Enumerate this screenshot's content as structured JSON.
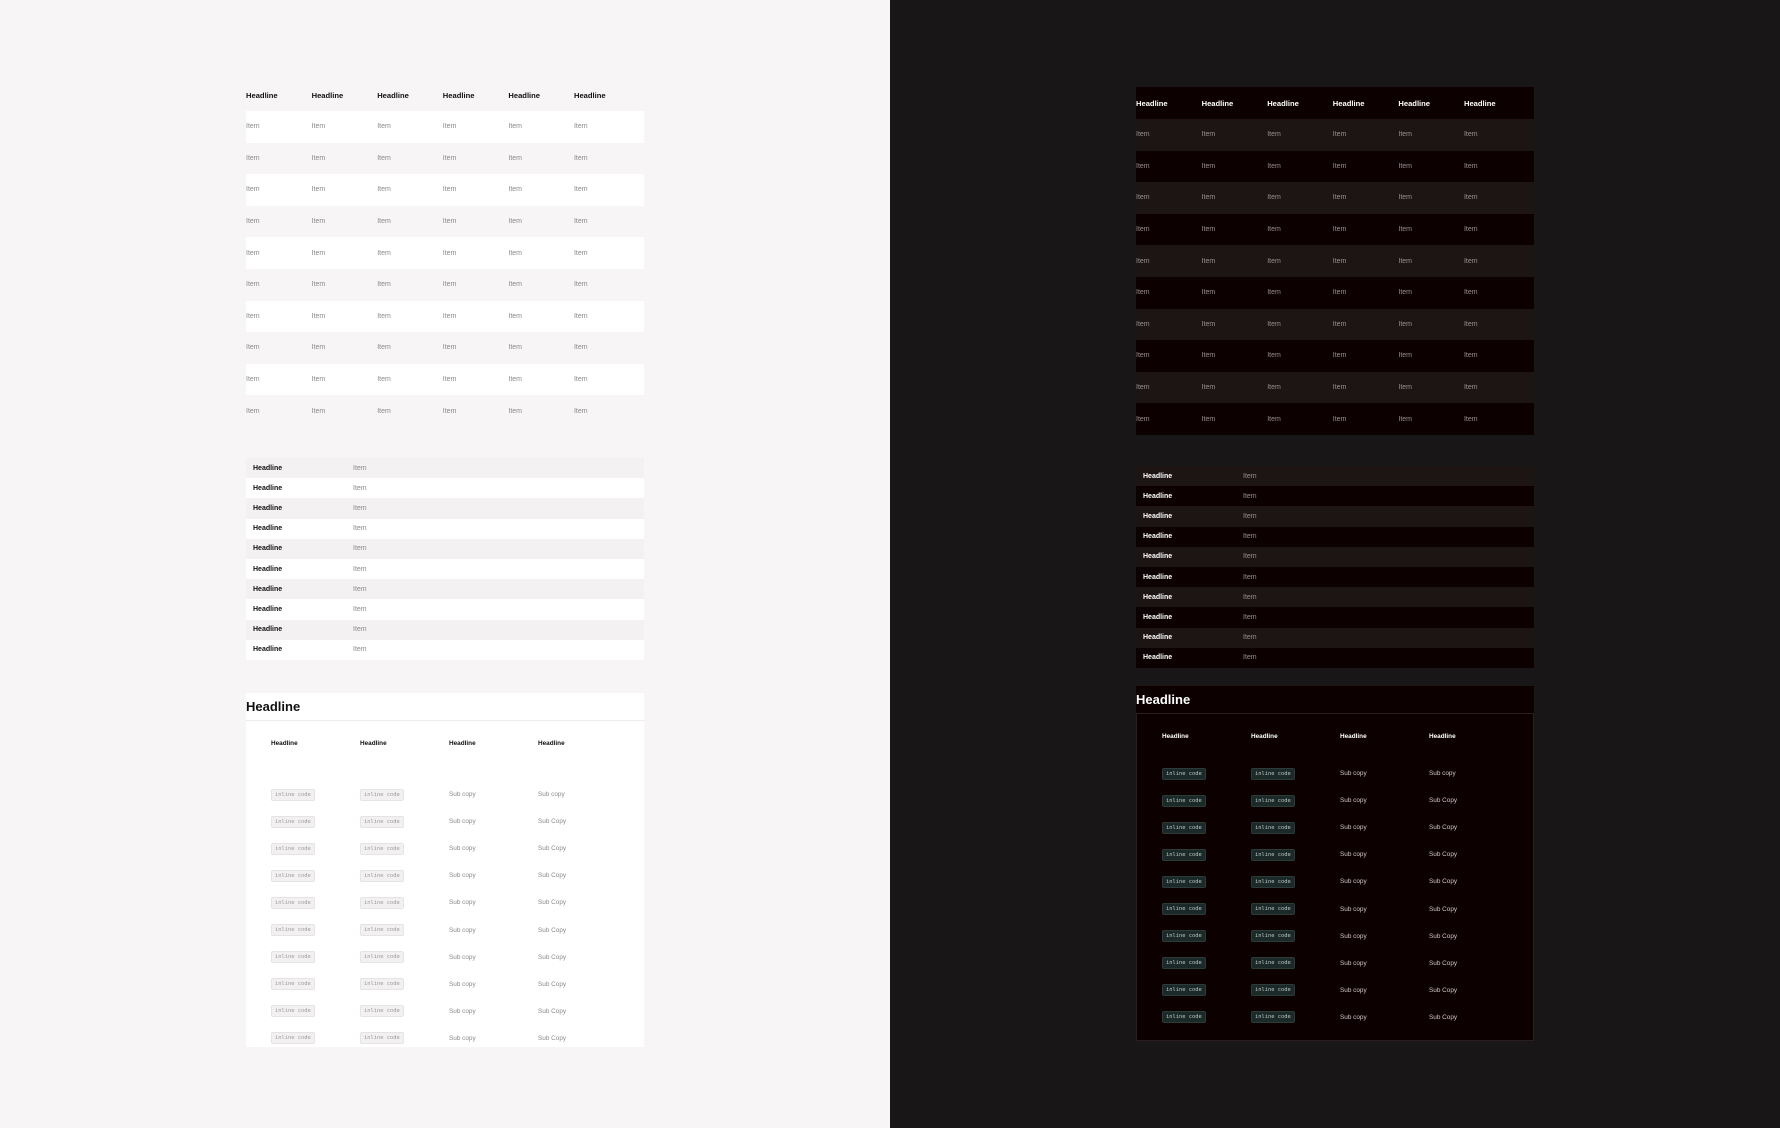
{
  "light": {
    "grid": {
      "headers": [
        "Headline",
        "Headline",
        "Headline",
        "Headline",
        "Headline",
        "Headline"
      ],
      "rows": [
        [
          "Item",
          "Item",
          "Item",
          "Item",
          "Item",
          "Item"
        ],
        [
          "Item",
          "Item",
          "Item",
          "Item",
          "Item",
          "Item"
        ],
        [
          "Item",
          "Item",
          "Item",
          "Item",
          "Item",
          "Item"
        ],
        [
          "Item",
          "Item",
          "Item",
          "Item",
          "Item",
          "Item"
        ],
        [
          "Item",
          "Item",
          "Item",
          "Item",
          "Item",
          "Item"
        ],
        [
          "Item",
          "Item",
          "Item",
          "Item",
          "Item",
          "Item"
        ],
        [
          "Item",
          "Item",
          "Item",
          "Item",
          "Item",
          "Item"
        ],
        [
          "Item",
          "Item",
          "Item",
          "Item",
          "Item",
          "Item"
        ],
        [
          "Item",
          "Item",
          "Item",
          "Item",
          "Item",
          "Item"
        ],
        [
          "Item",
          "Item",
          "Item",
          "Item",
          "Item",
          "Item"
        ]
      ]
    },
    "kv": [
      {
        "k": "Headline",
        "v": "Item"
      },
      {
        "k": "Headline",
        "v": "Item"
      },
      {
        "k": "Headline",
        "v": "Item"
      },
      {
        "k": "Headline",
        "v": "Item"
      },
      {
        "k": "Headline",
        "v": "Item"
      },
      {
        "k": "Headline",
        "v": "Item"
      },
      {
        "k": "Headline",
        "v": "Item"
      },
      {
        "k": "Headline",
        "v": "Item"
      },
      {
        "k": "Headline",
        "v": "Item"
      },
      {
        "k": "Headline",
        "v": "Item"
      }
    ],
    "section": {
      "title": "Headline",
      "headers": [
        "Headline",
        "Headline",
        "Headline",
        "Headline"
      ],
      "rows": [
        [
          "inline code",
          "inline code",
          "Sub copy",
          "Sub copy"
        ],
        [
          "inline code",
          "inline code",
          "Sub copy",
          "Sub Copy"
        ],
        [
          "inline code",
          "inline code",
          "Sub copy",
          "Sub Copy"
        ],
        [
          "inline code",
          "inline code",
          "Sub copy",
          "Sub Copy"
        ],
        [
          "inline code",
          "inline code",
          "Sub copy",
          "Sub Copy"
        ],
        [
          "inline code",
          "inline code",
          "Sub copy",
          "Sub Copy"
        ],
        [
          "inline code",
          "inline code",
          "Sub copy",
          "Sub Copy"
        ],
        [
          "inline code",
          "inline code",
          "Sub copy",
          "Sub Copy"
        ],
        [
          "inline code",
          "inline code",
          "Sub copy",
          "Sub Copy"
        ],
        [
          "inline code",
          "inline code",
          "Sub copy",
          "Sub Copy"
        ]
      ]
    }
  },
  "dark": {
    "grid": {
      "headers": [
        "Headline",
        "Headline",
        "Headline",
        "Headline",
        "Headline",
        "Headline"
      ],
      "rows": [
        [
          "Item",
          "Item",
          "Item",
          "Item",
          "Item",
          "Item"
        ],
        [
          "Item",
          "Item",
          "Item",
          "Item",
          "Item",
          "Item"
        ],
        [
          "Item",
          "Item",
          "Item",
          "Item",
          "Item",
          "Item"
        ],
        [
          "Item",
          "Item",
          "Item",
          "Item",
          "Item",
          "Item"
        ],
        [
          "Item",
          "Item",
          "Item",
          "Item",
          "Item",
          "Item"
        ],
        [
          "Item",
          "Item",
          "Item",
          "Item",
          "Item",
          "Item"
        ],
        [
          "Item",
          "Item",
          "Item",
          "Item",
          "Item",
          "Item"
        ],
        [
          "Item",
          "Item",
          "Item",
          "Item",
          "Item",
          "Item"
        ],
        [
          "Item",
          "Item",
          "Item",
          "Item",
          "Item",
          "Item"
        ],
        [
          "Item",
          "Item",
          "Item",
          "Item",
          "Item",
          "Item"
        ]
      ]
    },
    "kv": [
      {
        "k": "Headline",
        "v": "Item"
      },
      {
        "k": "Headline",
        "v": "Item"
      },
      {
        "k": "Headline",
        "v": "Item"
      },
      {
        "k": "Headline",
        "v": "Item"
      },
      {
        "k": "Headline",
        "v": "Item"
      },
      {
        "k": "Headline",
        "v": "Item"
      },
      {
        "k": "Headline",
        "v": "Item"
      },
      {
        "k": "Headline",
        "v": "Item"
      },
      {
        "k": "Headline",
        "v": "Item"
      },
      {
        "k": "Headline",
        "v": "Item"
      }
    ],
    "section": {
      "title": "Headline",
      "headers": [
        "Headline",
        "Headline",
        "Headline",
        "Headline"
      ],
      "rows": [
        [
          "inline code",
          "inline code",
          "Sub copy",
          "Sub copy"
        ],
        [
          "inline code",
          "inline code",
          "Sub copy",
          "Sub Copy"
        ],
        [
          "inline code",
          "inline code",
          "Sub copy",
          "Sub Copy"
        ],
        [
          "inline code",
          "inline code",
          "Sub copy",
          "Sub Copy"
        ],
        [
          "inline code",
          "inline code",
          "Sub copy",
          "Sub Copy"
        ],
        [
          "inline code",
          "inline code",
          "Sub copy",
          "Sub Copy"
        ],
        [
          "inline code",
          "inline code",
          "Sub copy",
          "Sub Copy"
        ],
        [
          "inline code",
          "inline code",
          "Sub copy",
          "Sub Copy"
        ],
        [
          "inline code",
          "inline code",
          "Sub copy",
          "Sub Copy"
        ],
        [
          "inline code",
          "inline code",
          "Sub copy",
          "Sub Copy"
        ]
      ]
    }
  },
  "colors": {
    "light_bg": "#f7f5f5",
    "dark_bg": "#181616",
    "dark_surface": "#0c0000",
    "dark_stripe": "#1d1414",
    "code_bg_dark": "#1b2a28"
  }
}
